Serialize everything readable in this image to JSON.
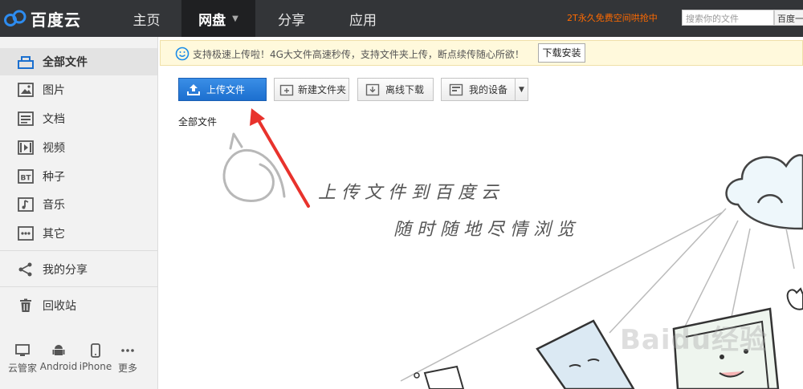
{
  "brand": {
    "logo_text": "百度云"
  },
  "nav": [
    {
      "label": "主页"
    },
    {
      "label": "网盘",
      "active": true
    },
    {
      "label": "分享"
    },
    {
      "label": "应用"
    }
  ],
  "header": {
    "promo": "2T永久免费空间哄抢中",
    "search_placeholder": "搜索你的文件",
    "search_button": "百度一"
  },
  "sidebar": {
    "items": [
      {
        "label": "全部文件",
        "icon": "all-files-icon",
        "active": true
      },
      {
        "label": "图片",
        "icon": "image-icon"
      },
      {
        "label": "文档",
        "icon": "document-icon"
      },
      {
        "label": "视频",
        "icon": "video-icon"
      },
      {
        "label": "种子",
        "icon": "torrent-icon"
      },
      {
        "label": "音乐",
        "icon": "music-icon"
      },
      {
        "label": "其它",
        "icon": "other-icon"
      },
      {
        "label": "我的分享",
        "icon": "share-icon"
      },
      {
        "label": "回收站",
        "icon": "trash-icon"
      }
    ],
    "devices": [
      {
        "label": "云管家",
        "icon": "monitor-icon"
      },
      {
        "label": "Android",
        "icon": "android-icon"
      },
      {
        "label": "iPhone",
        "icon": "phone-icon"
      },
      {
        "label": "更多",
        "icon": "more-icon"
      }
    ]
  },
  "notice": {
    "text": "支持极速上传啦！4G大文件高速秒传，支持文件夹上传，断点续传随心所欲！",
    "button": "下载安装"
  },
  "toolbar": {
    "upload": "上传文件",
    "new_folder": "新建文件夹",
    "offline_download": "离线下载",
    "my_devices": "我的设备"
  },
  "breadcrumb": "全部文件",
  "illustration": {
    "line1": "上传文件到百度云",
    "line2": "随时随地尽情浏览"
  },
  "watermark": "Baidu经验",
  "colors": {
    "topbar": "#333538",
    "primary_button": "#1c6fcf",
    "promo": "#ff6a00",
    "notice_bg": "#fff9dc",
    "arrow": "#e8322c"
  }
}
